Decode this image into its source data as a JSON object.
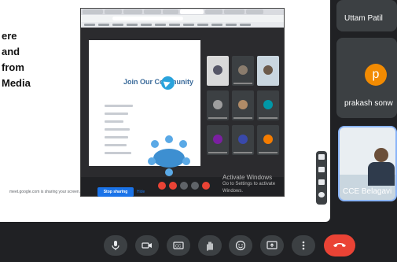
{
  "slide": {
    "lines": [
      "ere",
      "and",
      "from",
      "Media"
    ]
  },
  "inner_presentation": {
    "title": "Join Our Community"
  },
  "watermark": {
    "line1": "Activate Windows",
    "line2": "Go to Settings to activate Windows."
  },
  "share_bar": {
    "text": "meet.google.com is sharing your screen.",
    "stop_label": "Stop sharing",
    "hide_label": "Hide"
  },
  "participants": [
    {
      "name": "Uttam Patil"
    },
    {
      "name": "prakash sonw",
      "initial": "p"
    },
    {
      "name": "CCE Belagavi"
    }
  ],
  "colors": {
    "accent": "#1a73e8",
    "end_call": "#ea4335",
    "avatar": "#f28b02"
  },
  "controls": [
    {
      "icon": "mic-icon"
    },
    {
      "icon": "camera-icon"
    },
    {
      "icon": "captions-icon"
    },
    {
      "icon": "raise-hand-icon"
    },
    {
      "icon": "emoji-icon"
    },
    {
      "icon": "present-icon"
    },
    {
      "icon": "more-options-icon"
    },
    {
      "icon": "end-call-icon"
    }
  ]
}
